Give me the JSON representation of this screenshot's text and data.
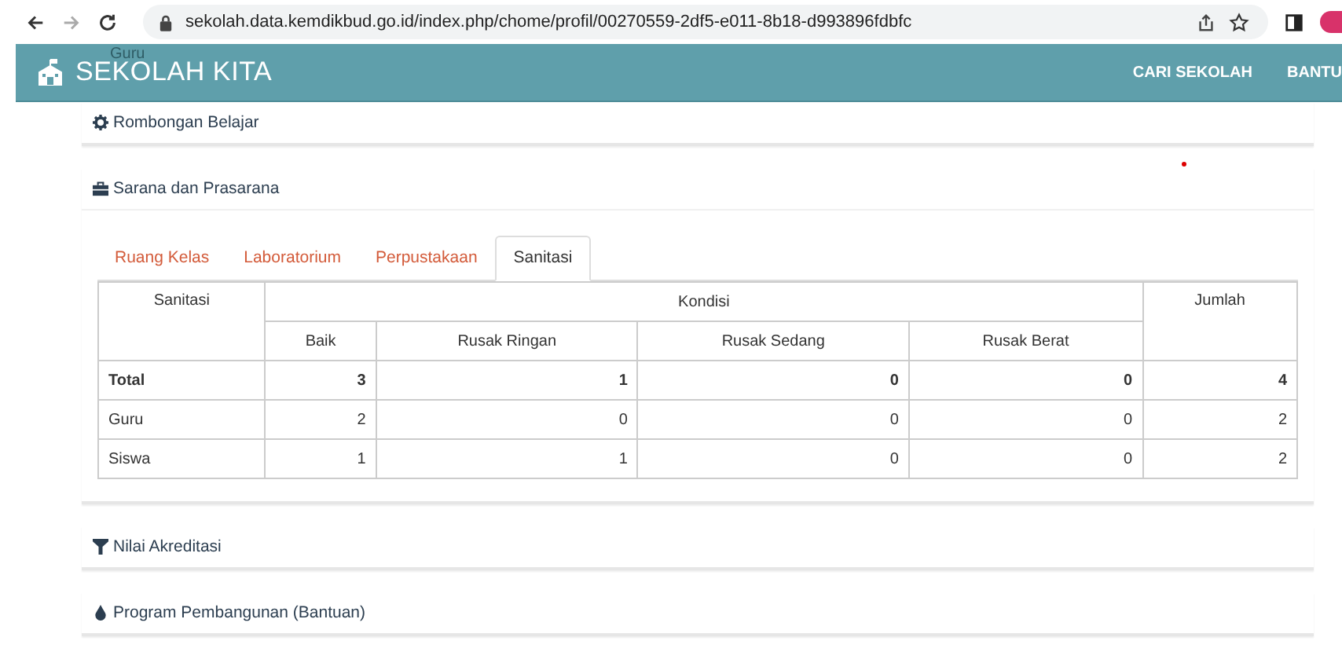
{
  "browser": {
    "url": "sekolah.data.kemdikbud.go.id/index.php/chome/profil/00270559-2df5-e011-8b18-d993896fdbfc"
  },
  "navbar": {
    "brand": "SEKOLAH KITA",
    "overlay_label": "Guru",
    "links": [
      "CARI SEKOLAH",
      "BANTU"
    ]
  },
  "sections": [
    {
      "kind": "gear",
      "title": "Rombongan Belajar"
    },
    {
      "kind": "briefcase",
      "title": "Sarana dan Prasarana",
      "tabs": [
        {
          "label": "Ruang Kelas",
          "selected": false
        },
        {
          "label": "Laboratorium",
          "selected": false
        },
        {
          "label": "Perpustakaan",
          "selected": false
        },
        {
          "label": "Sanitasi",
          "selected": true
        }
      ],
      "table": {
        "first_column": "Sanitasi",
        "group": "Kondisi",
        "subcolumns": [
          "Baik",
          "Rusak Ringan",
          "Rusak Sedang",
          "Rusak Berat"
        ],
        "last_column": "Jumlah",
        "rows": [
          {
            "label": "Total",
            "bold": true,
            "cells": [
              "3",
              "1",
              "0",
              "0",
              "4"
            ]
          },
          {
            "label": "Guru",
            "bold": false,
            "cells": [
              "2",
              "0",
              "0",
              "0",
              "2"
            ]
          },
          {
            "label": "Siswa",
            "bold": false,
            "cells": [
              "1",
              "1",
              "0",
              "0",
              "2"
            ]
          }
        ]
      }
    },
    {
      "kind": "filter",
      "title": "Nilai Akreditasi"
    },
    {
      "kind": "drop",
      "title": "Program Pembangunan (Bantuan)"
    }
  ]
}
